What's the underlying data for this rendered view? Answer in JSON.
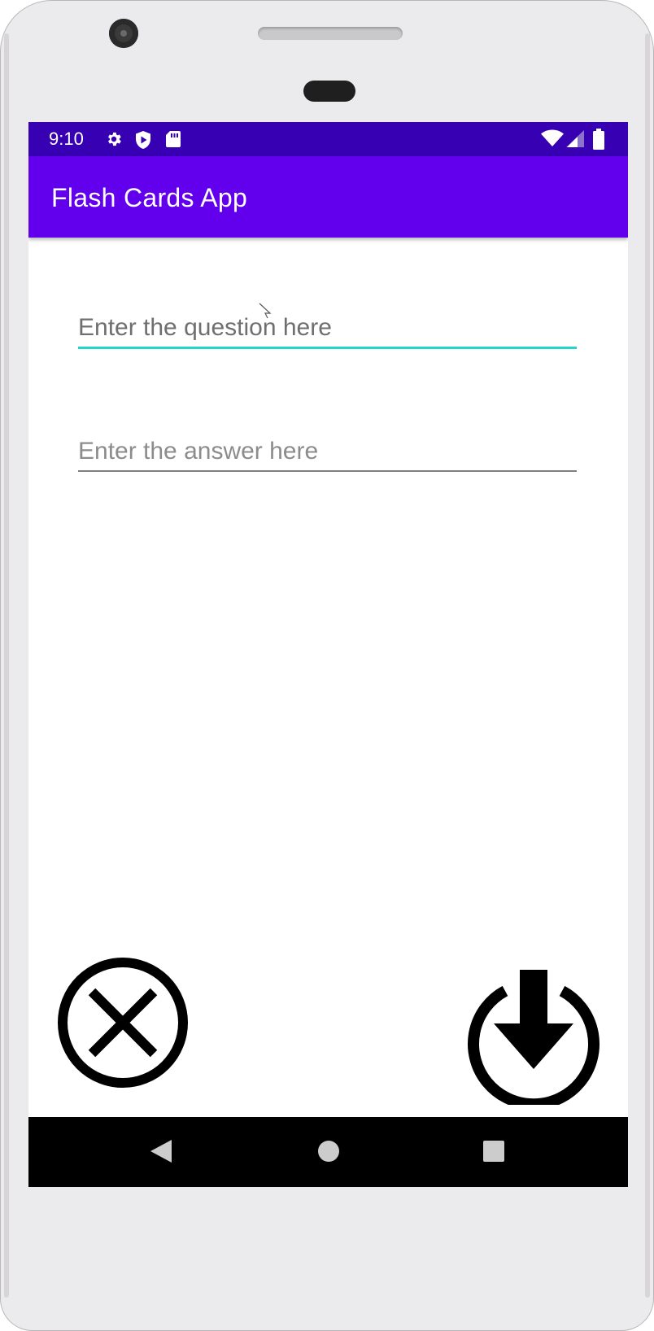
{
  "status_bar": {
    "time": "9:10",
    "left_icons": [
      "gear-icon",
      "shield-play-icon",
      "sd-card-icon"
    ],
    "right_icons": [
      "wifi-icon",
      "cell-signal-icon",
      "battery-icon"
    ],
    "background": "#3700b3"
  },
  "app_bar": {
    "title": "Flash Cards App",
    "background": "#6200ee"
  },
  "form": {
    "question_placeholder": "Enter the question here",
    "question_value": "",
    "answer_placeholder": "Enter the answer here",
    "answer_value": "",
    "focused_underline": "#26d4cc"
  },
  "actions": {
    "cancel_icon": "close-circle-icon",
    "save_icon": "download-circle-icon"
  },
  "nav_bar": {
    "buttons": [
      "back-icon",
      "home-icon",
      "recents-icon"
    ]
  }
}
